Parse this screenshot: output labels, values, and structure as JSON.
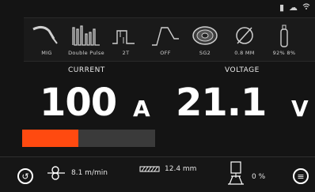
{
  "status_icons": [
    "document-icon",
    "cloud-icon",
    "wifi-icon"
  ],
  "process_params": [
    {
      "icon": "mig-torch-icon",
      "label": "MIG"
    },
    {
      "icon": "double-pulse-icon",
      "label": "Double Pulse"
    },
    {
      "icon": "2t-trigger-icon",
      "label": "2T"
    },
    {
      "icon": "off-curve-icon",
      "label": "OFF"
    },
    {
      "icon": "wire-spool-icon",
      "label": "SG2"
    },
    {
      "icon": "wire-diameter-icon",
      "label": "0.8 MM"
    },
    {
      "icon": "gas-cylinder-icon",
      "label": "92% 8%"
    }
  ],
  "current": {
    "label": "CURRENT",
    "value": "100",
    "unit": "A",
    "bar_fraction": 0.42
  },
  "voltage": {
    "label": "VOLTAGE",
    "value": "21.1",
    "unit": "V"
  },
  "footer": {
    "wire_speed": "8.1 m/min",
    "thickness": "12.4 mm",
    "percentage": "0 %"
  },
  "colors": {
    "accent": "#ff4a10",
    "background": "#141414",
    "text": "#ffffff"
  }
}
